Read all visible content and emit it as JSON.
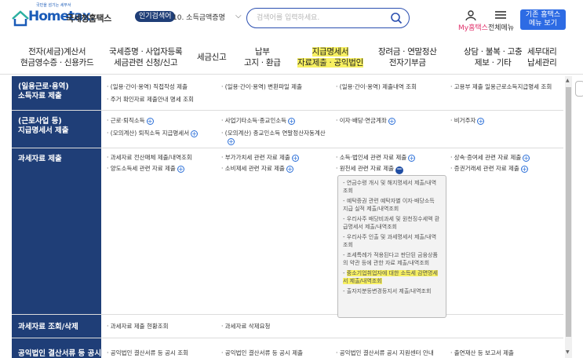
{
  "header": {
    "logo_small": "국민을 섬기는 세무서",
    "logo_brand": "Hometax.",
    "logo_org": "국세청홈택스",
    "keyword_badge": "인기검색어",
    "keyword_text": "10. 소득금액증명",
    "search_placeholder": "검색어를 입력하세요.",
    "myhome_label": "My홈택스",
    "menu_label": "전체메뉴",
    "basic_menu_line1": "기존 홈택스",
    "basic_menu_line2": "메뉴 보기"
  },
  "nav": [
    {
      "l1": "전자(세금)계산서",
      "l2": "현금영수증 · 신용카드"
    },
    {
      "l1": "국세증명 · 사업자등록",
      "l2": "세금관련 신청/신고"
    },
    {
      "l1": "세금신고",
      "l2": ""
    },
    {
      "l1": "납부",
      "l2": "고지 · 환급"
    },
    {
      "l1": "지급명세서",
      "l2": "자료제출 · 공익법인"
    },
    {
      "l1": "장려금 · 연말정산",
      "l2": "전자기부금"
    },
    {
      "l1": "상담 · 불복 · 고충",
      "l2": "제보 · 기타"
    },
    {
      "l1": "세무대리",
      "l2": "납세관리"
    }
  ],
  "rows": [
    {
      "head1": "(일용근로·용역)",
      "head2": "소득자료 제출",
      "items": [
        "(일용·간이·용역) 직접작성 제출",
        "(일용·간이·용역) 변환파일 제출",
        "(일용·간이·용역) 제출내역 조회",
        "고용부 제출 일용근로소득지급명세 조회",
        "주거 확인자료 제출안내 명세 조회"
      ]
    },
    {
      "head1": "(근로사업 등)",
      "head2": "지급명세서 제출",
      "items": [
        "근로·퇴직소득",
        "사업기타소득·종교인소득",
        "이자·배당·연금계좌",
        "비거주자",
        "(모의계산) 퇴직소득 지급명세서",
        "(모의계산) 종교인소득 연말정산자동계산"
      ]
    },
    {
      "head1": "과세자료 제출",
      "head2": "",
      "items": [
        "과세자료 전산매체 제출/내역조회",
        "부가가치세 관련 자료 제출",
        "소득·법인세 관련 자료 제출",
        "상속·증여세 관련 자료 제출",
        "양도소득세 관련 자료 제출",
        "소비제세 관련 자료 제출",
        "원천세 관련 자료 제출",
        "증권거래세 관련 자료 제출"
      ]
    },
    {
      "head1": "과세자료 조회/삭제",
      "head2": "",
      "items": [
        "과세자료 제출 현황조회",
        "과세자료 삭제요청"
      ]
    },
    {
      "head1": "공익법인 결산서류 등 공시",
      "head2": "",
      "items": [
        "공익법인 결산서류 등 공시 조회",
        "공익법인 결산서류 등 공시 제출",
        "공익법인 결산서류 공시 지원센터 안내",
        "출연재산 등 보고서 제출"
      ]
    }
  ],
  "popup": [
    "연금수령 개시 및 해지명세서 제출/내역조회",
    "예탁증권 관련 예탁자별 이자·배당소득 지급 실적 제출/내역조회",
    "우리사주 배당비과세 및 원천징수세액 환급명세서 제출/내역조회",
    "우리사주 인출 및 과세명세서 제출/내역조회",
    "조세특례가 적용된다고 판단된 금융상품의 약관 등에 관한 자료 제출/내역조회",
    "중소기업취업자에 대한 소득세 감면명세서 제출/내역조회",
    "출자지분등변경등지서 제출/내역조회"
  ],
  "colors": {
    "navy": "#1f3e77",
    "highlight": "#f7f061",
    "accent": "#2d6be4",
    "pink": "#e0316b"
  }
}
